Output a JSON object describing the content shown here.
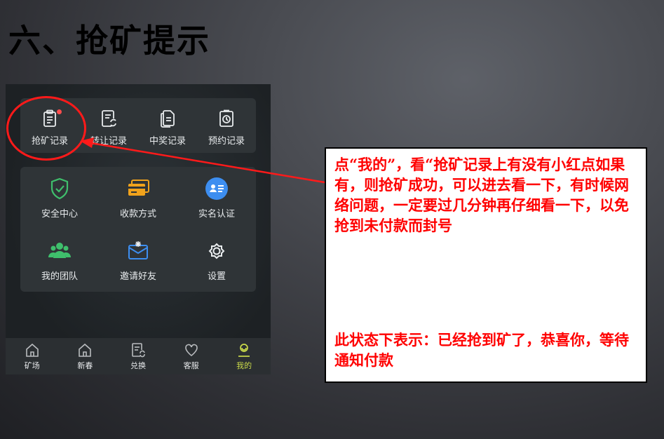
{
  "slide": {
    "title": "六、抢矿提示"
  },
  "records": [
    {
      "label": "抢矿记录",
      "icon": "clipboard-icon",
      "has_dot": true
    },
    {
      "label": "转让记录",
      "icon": "transfer-doc-icon",
      "has_dot": false
    },
    {
      "label": "中奖记录",
      "icon": "files-icon",
      "has_dot": false
    },
    {
      "label": "预约记录",
      "icon": "clock-doc-icon",
      "has_dot": false
    }
  ],
  "menu": [
    {
      "label": "安全中心",
      "icon": "shield-check-icon"
    },
    {
      "label": "收款方式",
      "icon": "cards-icon"
    },
    {
      "label": "实名认证",
      "icon": "id-card-icon"
    },
    {
      "label": "我的团队",
      "icon": "team-icon"
    },
    {
      "label": "邀请好友",
      "icon": "invite-mail-icon"
    },
    {
      "label": "设置",
      "icon": "gear-icon"
    }
  ],
  "tabs": [
    {
      "label": "矿场",
      "icon": "home-icon"
    },
    {
      "label": "新春",
      "icon": "home-icon"
    },
    {
      "label": "兑换",
      "icon": "exchange-doc-icon"
    },
    {
      "label": "客服",
      "icon": "heart-icon"
    },
    {
      "label": "我的",
      "icon": "profile-icon",
      "active": true
    }
  ],
  "annotation": {
    "text": "点“我的”，看“抢矿记录上有没有小红点如果有，则抢矿成功，可以进去看一下，有时候网络问题，一定要过几分钟再仔细看一下，以免抢到未付款而封号",
    "status": "此状态下表示：已经抢到矿了，恭喜你，等待通知付款"
  },
  "colors": {
    "accent_red": "#ff0000",
    "green": "#3fbf6c",
    "tab_active": "#c9d94a"
  }
}
